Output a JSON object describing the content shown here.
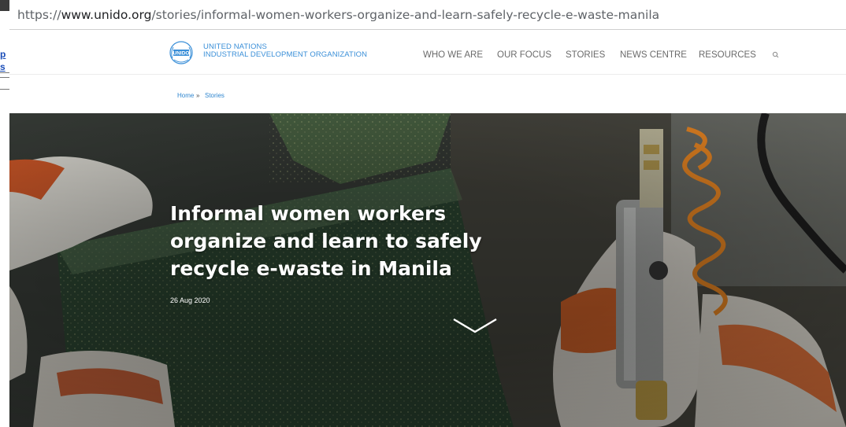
{
  "tooltip": {
    "url_prefix": "https://",
    "url_host": "www.unido.org",
    "url_path": "/stories/informal-women-workers-organize-and-learn-safely-recycle-e-waste-manila"
  },
  "background_window": {
    "link_1": "p",
    "link_2": "s"
  },
  "header": {
    "logo_mark": "UNIDO",
    "org_line_1": "United Nations",
    "org_line_2": "Industrial Development Organization",
    "nav": [
      {
        "label": "WHO WE ARE"
      },
      {
        "label": "OUR FOCUS"
      },
      {
        "label": "STORIES"
      },
      {
        "label": "NEWS CENTRE"
      },
      {
        "label": "RESOURCES"
      }
    ],
    "search_icon": "search-icon"
  },
  "breadcrumb": {
    "home": "Home",
    "separator": "»",
    "current": "Stories"
  },
  "hero": {
    "title": "Informal women workers organize and learn to safely recycle e-waste in Manila",
    "date": "26 Aug 2020",
    "scroll_icon": "chevron-down-icon"
  },
  "colors": {
    "brand_blue": "#3a8fd8",
    "nav_text": "#6b6b6b",
    "link": "#2f86cf"
  }
}
